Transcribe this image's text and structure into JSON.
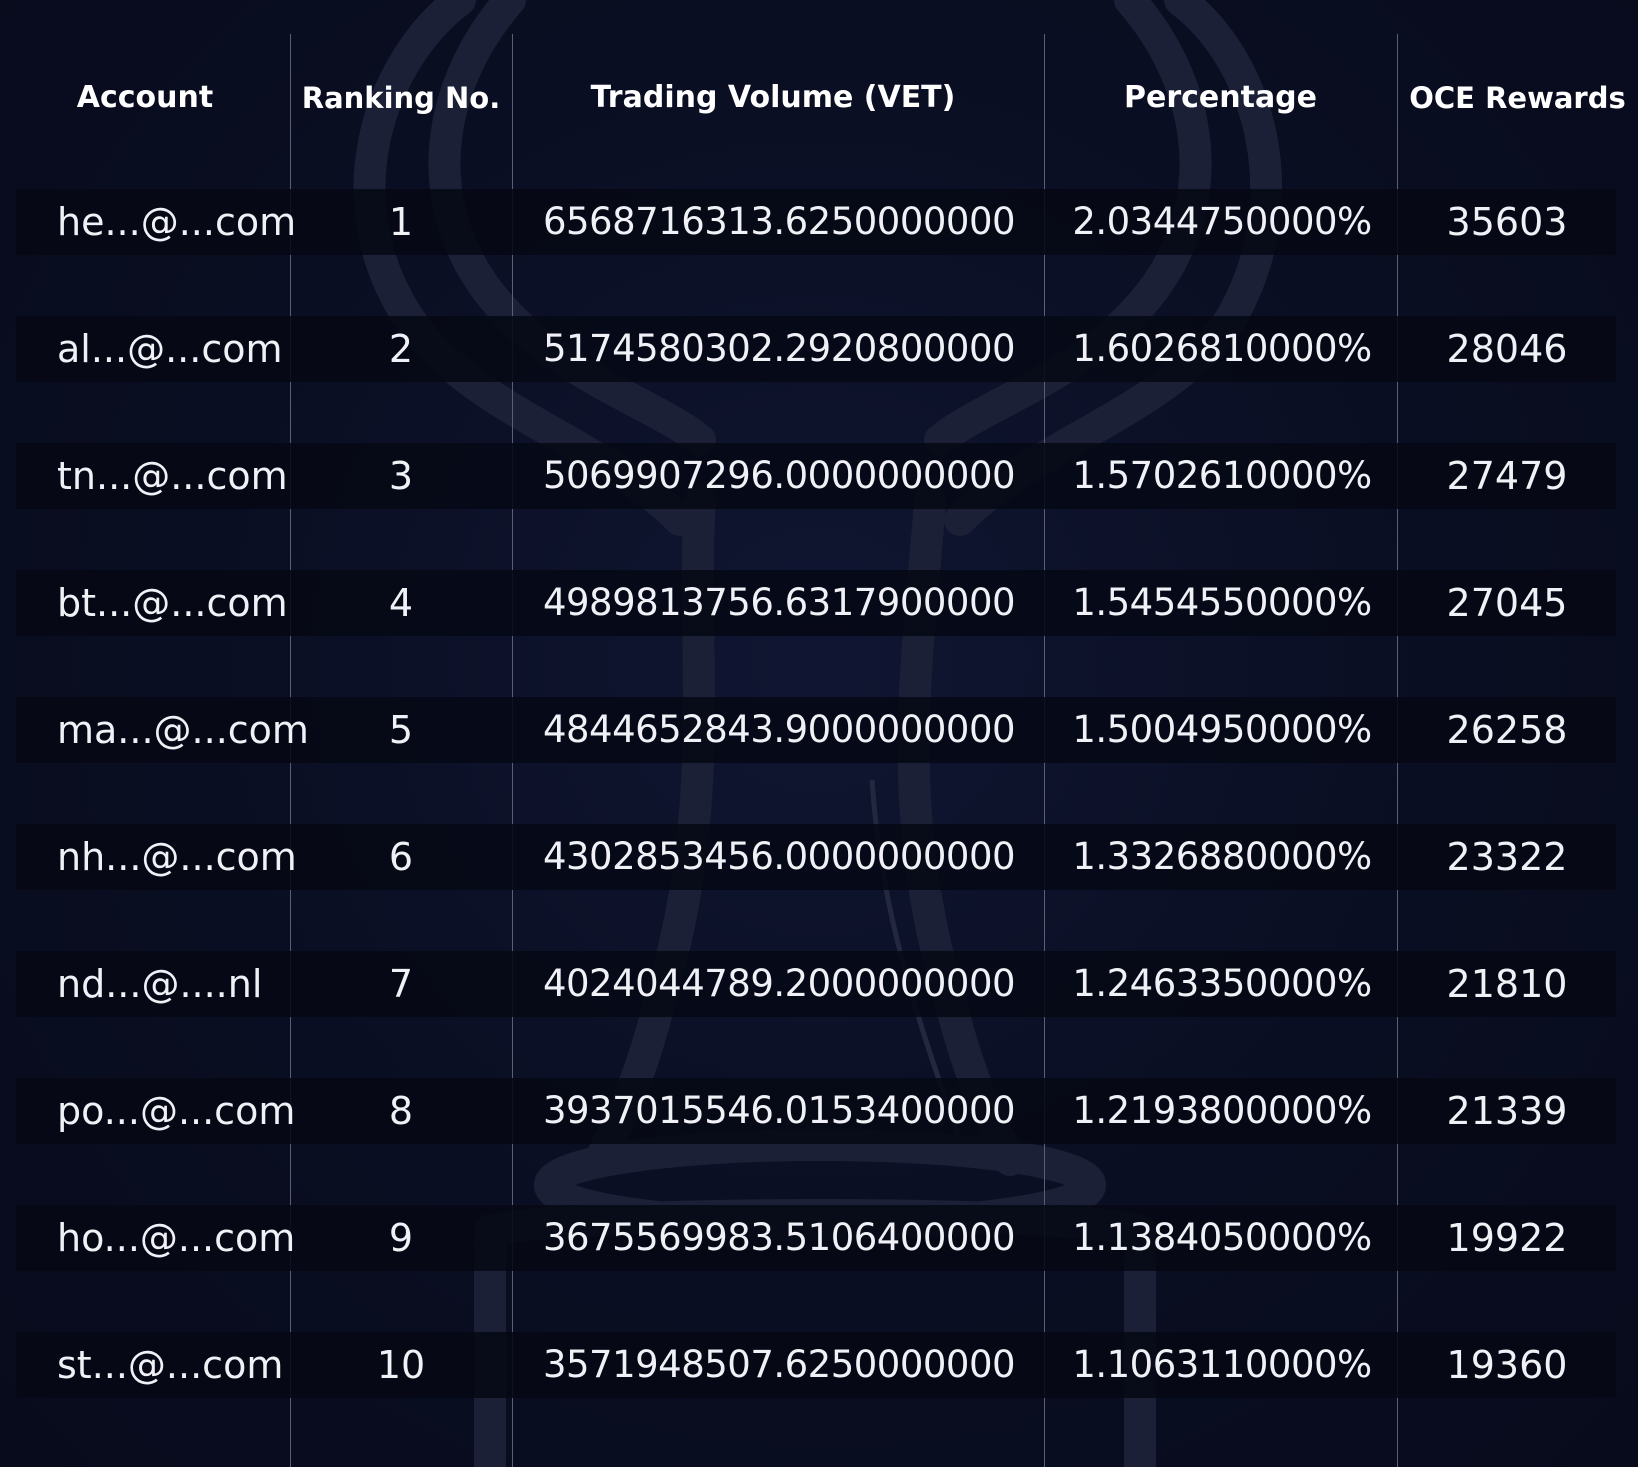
{
  "table": {
    "columns": {
      "account": "Account",
      "rank": "Ranking No.",
      "volume": "Trading Volume (VET)",
      "percentage": "Percentage",
      "reward": "OCE Rewards"
    },
    "rows": [
      {
        "account": "he...@...com",
        "rank": "1",
        "volume": "6568716313.6250000000",
        "percentage": "2.0344750000%",
        "reward": "35603"
      },
      {
        "account": "al...@...com",
        "rank": "2",
        "volume": "5174580302.2920800000",
        "percentage": "1.6026810000%",
        "reward": "28046"
      },
      {
        "account": "tn...@...com",
        "rank": "3",
        "volume": "5069907296.0000000000",
        "percentage": "1.5702610000%",
        "reward": "27479"
      },
      {
        "account": "bt...@...com",
        "rank": "4",
        "volume": "4989813756.6317900000",
        "percentage": "1.5454550000%",
        "reward": "27045"
      },
      {
        "account": "ma...@...com",
        "rank": "5",
        "volume": "4844652843.9000000000",
        "percentage": "1.5004950000%",
        "reward": "26258"
      },
      {
        "account": "nh...@...com",
        "rank": "6",
        "volume": "4302853456.0000000000",
        "percentage": "1.3326880000%",
        "reward": "23322"
      },
      {
        "account": "nd...@....nl",
        "rank": "7",
        "volume": "4024044789.2000000000",
        "percentage": "1.2463350000%",
        "reward": "21810"
      },
      {
        "account": "po...@...com",
        "rank": "8",
        "volume": "3937015546.0153400000",
        "percentage": "1.2193800000%",
        "reward": "21339"
      },
      {
        "account": "ho...@...com",
        "rank": "9",
        "volume": "3675569983.5106400000",
        "percentage": "1.1384050000%",
        "reward": "19922"
      },
      {
        "account": "st...@...com",
        "rank": "10",
        "volume": "3571948507.6250000000",
        "percentage": "1.1063110000%",
        "reward": "19360"
      }
    ]
  },
  "background": {
    "icon": "trophy-icon",
    "color": "#0a0e22"
  }
}
